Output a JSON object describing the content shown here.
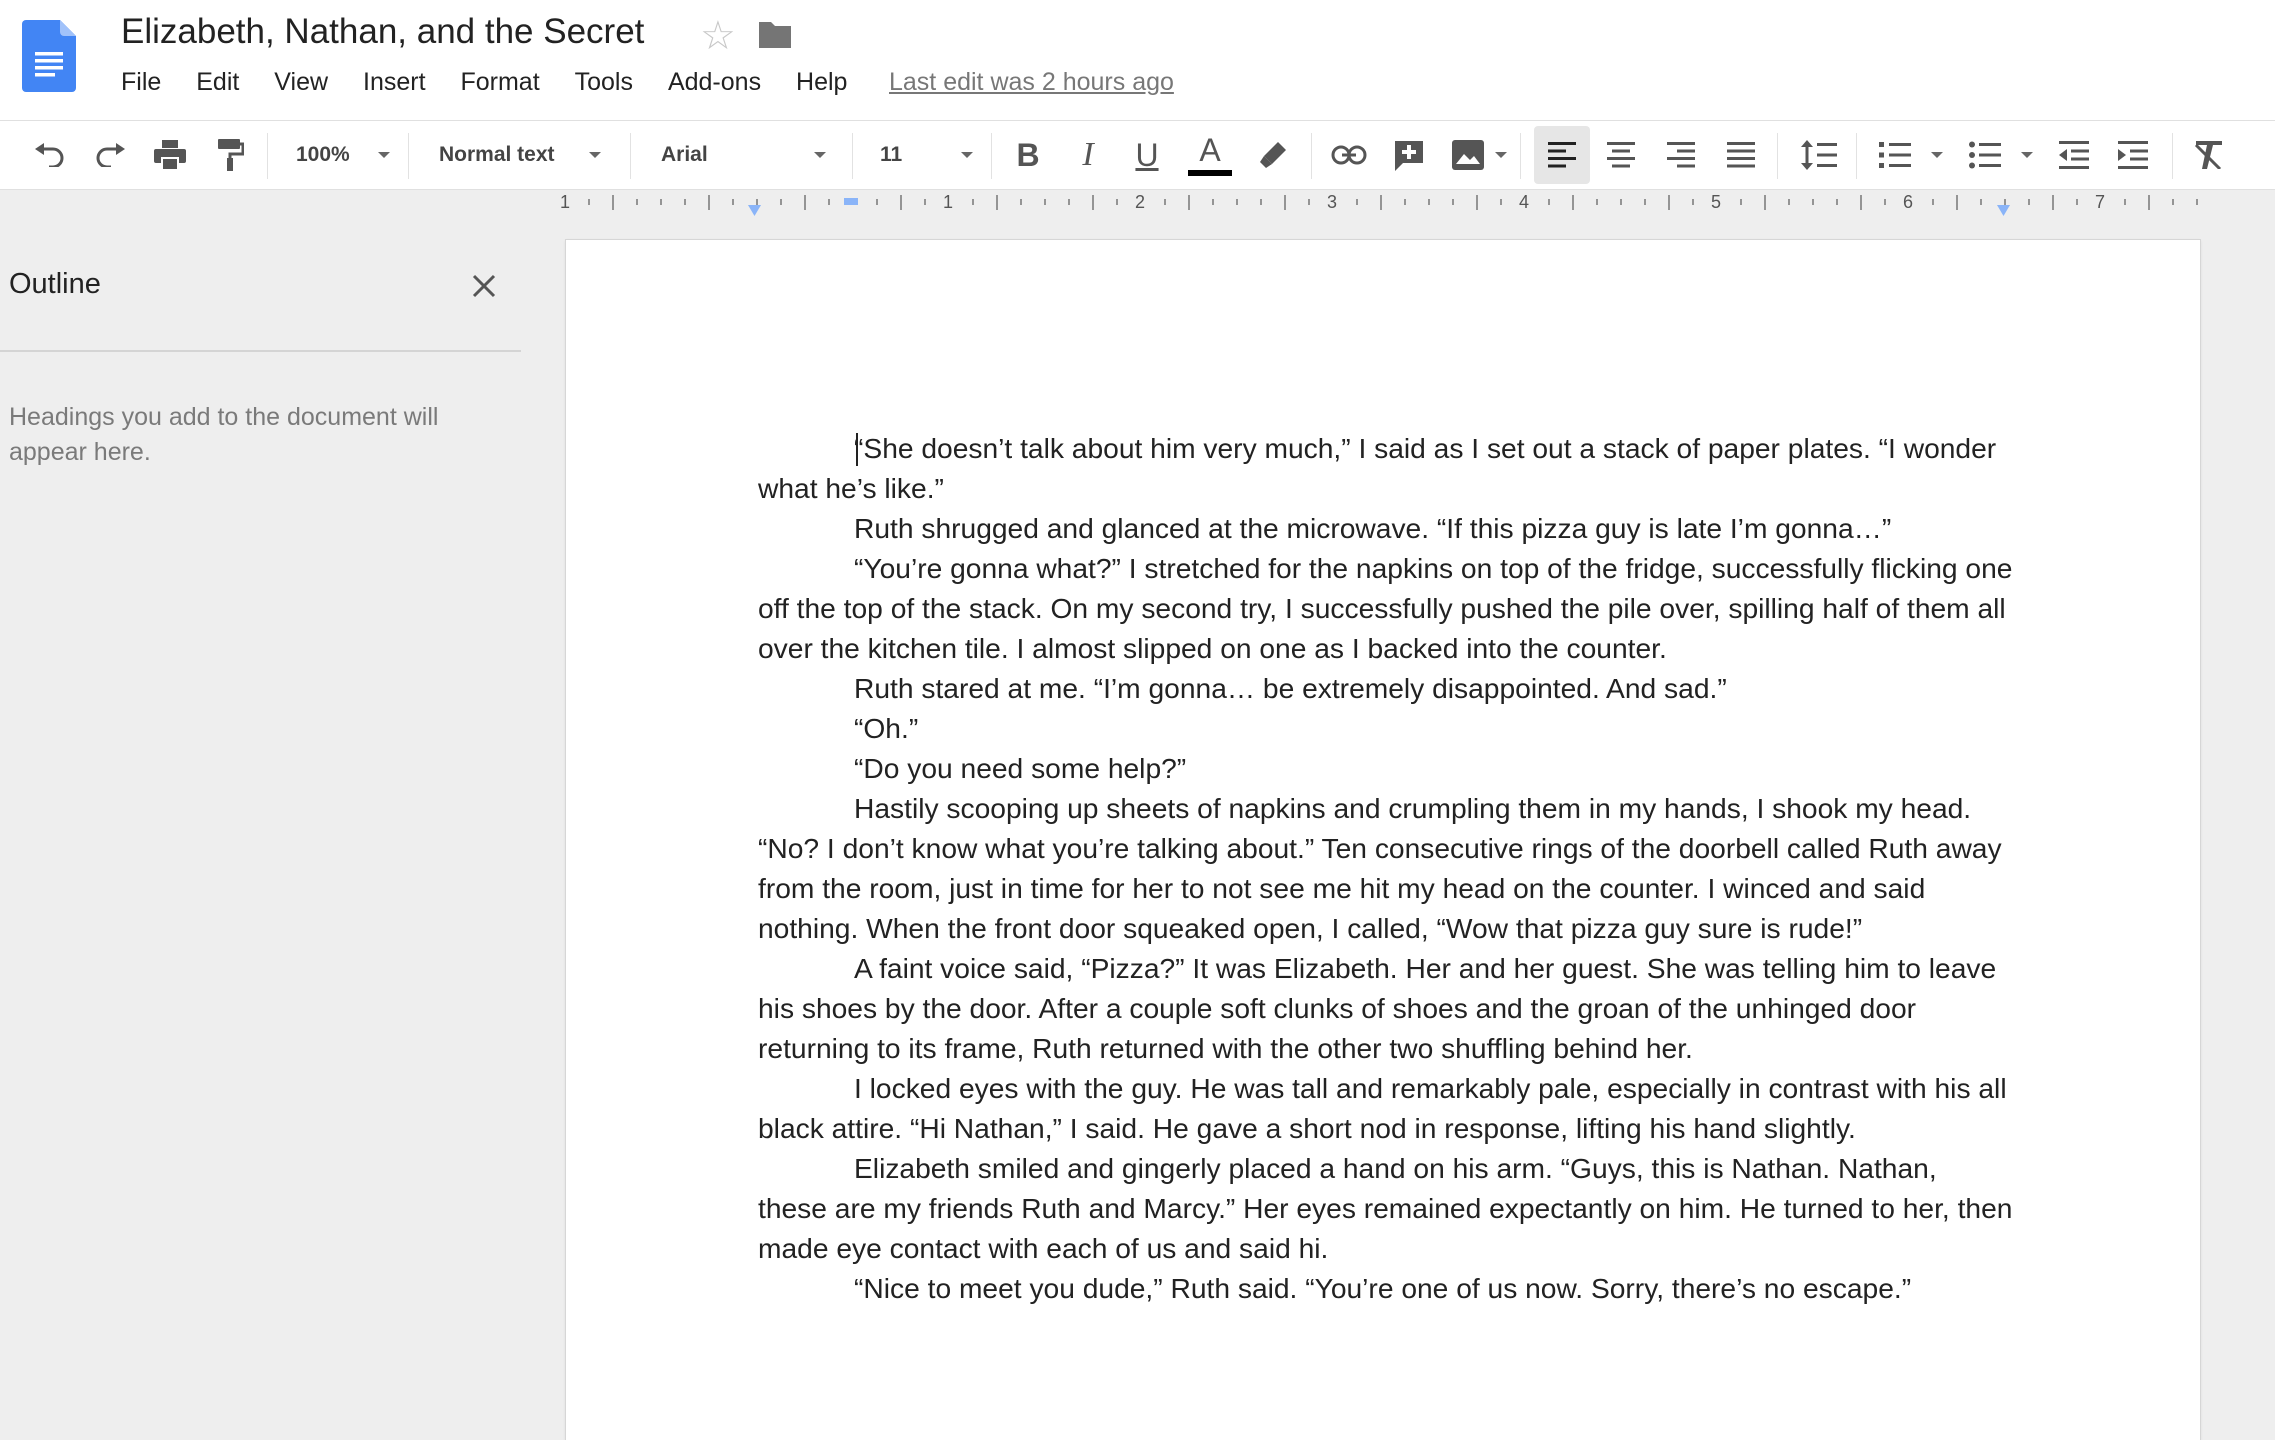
{
  "header": {
    "title": "Elizabeth, Nathan, and the Secret",
    "star_icon": "star-icon",
    "folder_icon": "folder-icon",
    "last_edit": "Last edit was 2 hours ago"
  },
  "menu": [
    "File",
    "Edit",
    "View",
    "Insert",
    "Format",
    "Tools",
    "Add-ons",
    "Help"
  ],
  "toolbar": {
    "zoom": "100%",
    "style": "Normal text",
    "font": "Arial",
    "font_size": "11",
    "bold_label": "B",
    "italic_label": "I",
    "underline_label": "U",
    "text_color_label": "A",
    "text_color": "#000000"
  },
  "ruler": {
    "numbers": [
      "1",
      "1",
      "2",
      "3",
      "4",
      "5",
      "6",
      "7"
    ],
    "marker_color": "#8ab4f8"
  },
  "outline": {
    "title": "Outline",
    "hint": "Headings you add to the document will appear here."
  },
  "document": {
    "paragraphs": [
      "“She doesn’t talk about him very much,” I said as I set out a stack of paper plates. “I wonder what he’s like.”",
      "Ruth shrugged and glanced at the microwave. “If this pizza guy is late I’m gonna…”",
      "“You’re gonna what?” I stretched for the napkins on top of the fridge, successfully flicking one off the top of the stack. On my second try, I successfully pushed the pile over, spilling half of them all over the kitchen tile. I almost slipped on one as I backed into the counter.",
      "Ruth stared at me. “I’m gonna… be extremely disappointed. And sad.”",
      "“Oh.”",
      "“Do you need some help?”",
      "Hastily scooping up sheets of napkins and crumpling them in my hands, I shook my head. “No? I don’t know what you’re talking about.” Ten consecutive rings of the doorbell called Ruth away from the room, just in time for her to not see me hit my head on the counter. I winced and said nothing. When the front door squeaked open, I called, “Wow that pizza guy sure is rude!”",
      "A faint voice said, “Pizza?” It was Elizabeth. Her and her guest. She was telling him to leave his shoes by the door. After a couple soft clunks of shoes and the groan of the unhinged door returning to its frame, Ruth returned with the other two shuffling behind her.",
      "I locked eyes with the guy. He was tall and remarkably pale, especially in contrast with his all black attire. “Hi Nathan,” I said. He gave a short nod in response, lifting his hand slightly.",
      "Elizabeth smiled and gingerly placed a hand on his arm. “Guys, this is Nathan. Nathan, these are my friends Ruth and Marcy.” Her eyes remained expectantly on him. He turned to her, then made eye contact with each of us and said hi.",
      "“Nice to meet you dude,” Ruth said. “You’re one of us now. Sorry, there’s no escape.”"
    ]
  },
  "colors": {
    "docs_blue": "#4285f4",
    "selected_button": "#e6e6e6"
  }
}
